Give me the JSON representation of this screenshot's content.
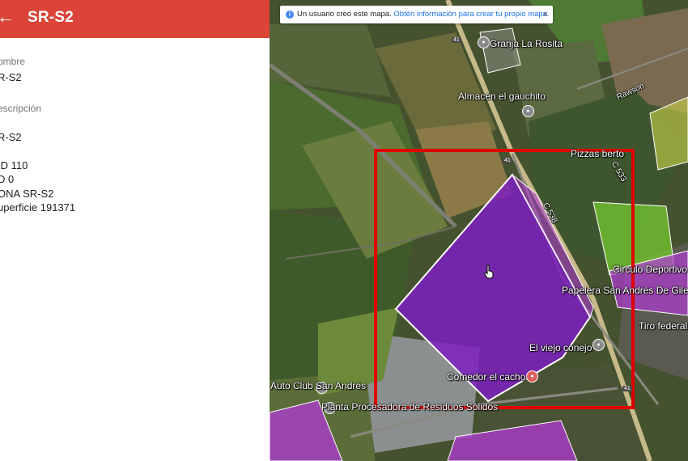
{
  "panel": {
    "title": "SR-S2",
    "back_icon": "arrow-left-icon",
    "name_label": "ombre",
    "name_value": "R-S2",
    "description_label": "escripción",
    "description_lines": [
      "R-S2",
      "",
      "ID 110",
      "D 0",
      "ONA SR-S2",
      "uperficie 191371"
    ]
  },
  "notice": {
    "info_icon": "info-icon",
    "text": "Un usuario creó este mapa.",
    "link": "Obtén información para crear tu propio mapa.",
    "close": "×"
  },
  "map": {
    "colors": {
      "selected_polygon": "#7d1fc0",
      "purple_polygon": "#b03ad4",
      "green_polygon": "#7bd12f",
      "yellow_polygon": "#c9d64a",
      "highlight_box": "#e00000"
    },
    "places": [
      "Granja La Rosita",
      "Almacén el gauchito",
      "Pizzas berto",
      "Circulo Deportivo Familiar",
      "Papelera San Andrés De Giles",
      "Tiro federal",
      "El viejo conejo",
      "Comedor el cacho",
      "Auto Club San Andrés",
      "Planta Procesadora de Residuos Sólidos"
    ],
    "streets": [
      "Rawson",
      "C 533",
      "C 538"
    ],
    "route_shields": [
      "41",
      "41",
      "41"
    ]
  }
}
